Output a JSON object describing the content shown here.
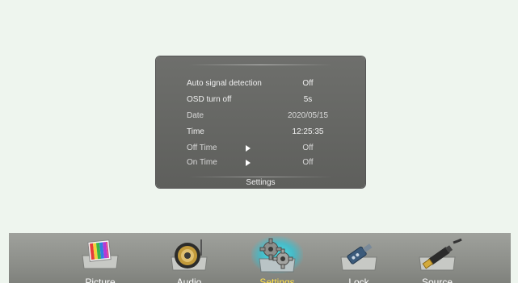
{
  "panel": {
    "title": "Settings",
    "rows": [
      {
        "label": "Auto signal detection",
        "value": "Off"
      },
      {
        "label": "OSD turn off",
        "value": "5s"
      },
      {
        "label": "Date",
        "value": "2020/05/15"
      },
      {
        "label": "Time",
        "value": "12:25:35"
      },
      {
        "label": "Off Time",
        "value": "Off"
      },
      {
        "label": "On Time",
        "value": "Off"
      }
    ]
  },
  "menu": {
    "active": "Settings",
    "items": [
      {
        "label": "Picture",
        "icon": "picture-icon"
      },
      {
        "label": "Audio",
        "icon": "speaker-icon"
      },
      {
        "label": "Settings",
        "icon": "gears-icon"
      },
      {
        "label": "Lock",
        "icon": "lock-icon"
      },
      {
        "label": "Source",
        "icon": "hdmi-cable-icon"
      }
    ]
  },
  "colors": {
    "background": "#eef5ee",
    "panel": "#666764",
    "menubar": "#959792",
    "active_label": "#ffe24a",
    "active_glow": "#46e6f0"
  }
}
